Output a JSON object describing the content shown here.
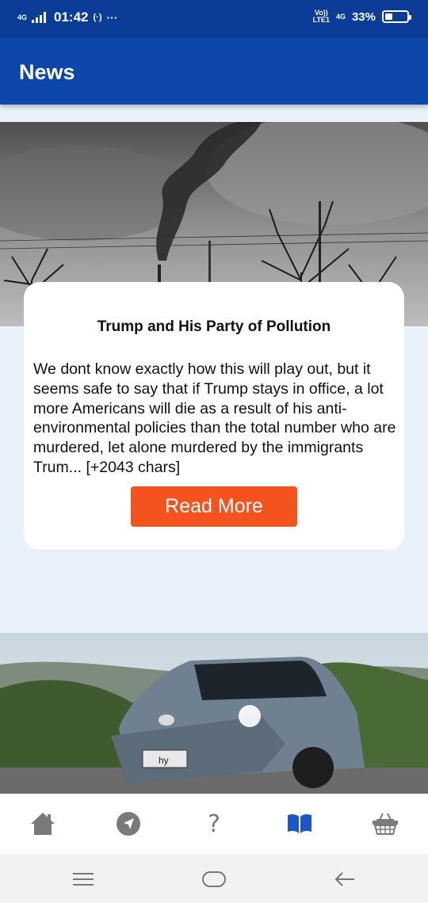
{
  "status_bar": {
    "network_left": "4G",
    "signal_label": "G",
    "time": "01:42",
    "volte_label": "Vo))\nLTE1",
    "network_right": "4G",
    "battery": "33%",
    "battery_level": 0.33
  },
  "app_bar": {
    "title": "News"
  },
  "articles": [
    {
      "title": "Trump and His Party of Pollution",
      "description": "We dont know exactly how this will play out, but it seems safe to say that if Trump stays in office, a lot more Americans will die as a result of his anti-environmental policies than the total number who are murdered, let alone murdered by the immigrants Trum... [+2043 chars]",
      "button_label": "Read More"
    }
  ],
  "car_plate": "hy",
  "bottom_nav": {
    "items": [
      "home-icon",
      "navigation-icon",
      "help-icon",
      "book-icon",
      "basket-icon"
    ],
    "help_glyph": "?",
    "active_color": "#1a56c9",
    "inactive_color": "#7a7a7a"
  },
  "colors": {
    "accent": "#f5531e",
    "primary": "#0c47a9",
    "status": "#0b3d98"
  }
}
